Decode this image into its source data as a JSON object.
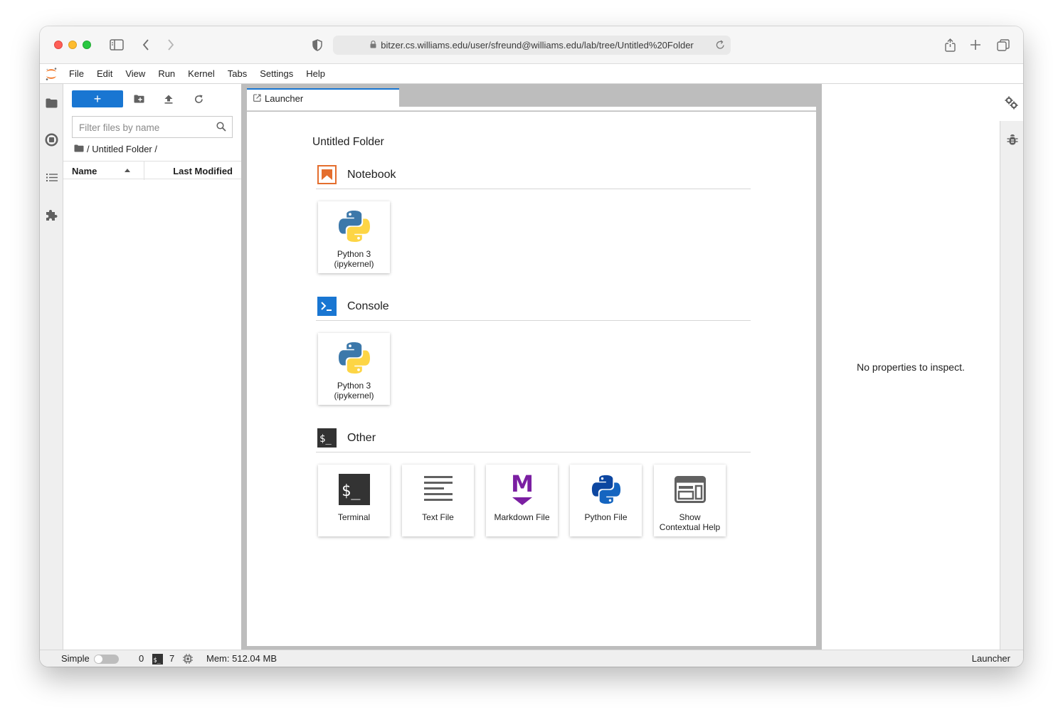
{
  "browser": {
    "url": "bitzer.cs.williams.edu/user/sfreund@williams.edu/lab/tree/Untitled%20Folder"
  },
  "menubar": {
    "items": [
      "File",
      "Edit",
      "View",
      "Run",
      "Kernel",
      "Tabs",
      "Settings",
      "Help"
    ]
  },
  "filebrowser": {
    "new_label": "+",
    "filter_placeholder": "Filter files by name",
    "breadcrumb": "/ Untitled Folder /",
    "col_name": "Name",
    "col_modified": "Last Modified"
  },
  "tab": {
    "label": "Launcher"
  },
  "launcher": {
    "folder_title": "Untitled Folder",
    "sections": [
      {
        "label": "Notebook",
        "cards": [
          {
            "line1": "Python 3",
            "line2": "(ipykernel)"
          }
        ]
      },
      {
        "label": "Console",
        "cards": [
          {
            "line1": "Python 3",
            "line2": "(ipykernel)"
          }
        ]
      },
      {
        "label": "Other",
        "cards": [
          {
            "line1": "Terminal",
            "line2": ""
          },
          {
            "line1": "Text File",
            "line2": ""
          },
          {
            "line1": "Markdown File",
            "line2": ""
          },
          {
            "line1": "Python File",
            "line2": ""
          },
          {
            "line1": "Show",
            "line2": "Contextual Help"
          }
        ]
      }
    ],
    "terminal_glyph": "$_",
    "markdown_glyph": "M"
  },
  "inspector": {
    "empty_text": "No properties to inspect."
  },
  "statusbar": {
    "mode_label": "Simple",
    "kernels_count": "0",
    "terminals_count": "7",
    "terminal_glyph": "$_",
    "memory": "Mem: 512.04 MB",
    "right_label": "Launcher"
  }
}
